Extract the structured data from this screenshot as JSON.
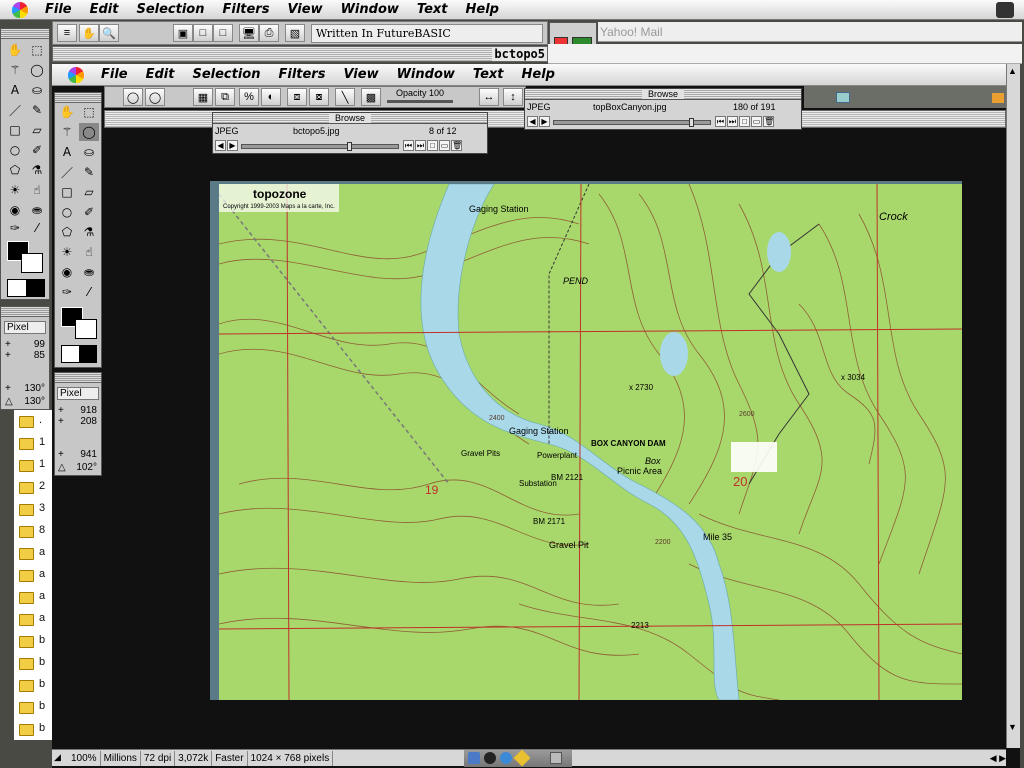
{
  "menu_outer": [
    "File",
    "Edit",
    "Selection",
    "Filters",
    "View",
    "Window",
    "Text",
    "Help"
  ],
  "menu_inner": [
    "File",
    "Edit",
    "Selection",
    "Filters",
    "View",
    "Window",
    "Text",
    "Help"
  ],
  "toolbar_outer_title": "Written In FutureBASIC",
  "doc_window_title": "bctopo5",
  "yahoo_title": "Yahoo! Mail",
  "toolbar_inner": {
    "opacity_label": "Opacity 100"
  },
  "browse_small": {
    "title": "Browse",
    "type": "JPEG",
    "filename": "bctopo5.jpg",
    "position": "8 of 12",
    "slider": 0.7
  },
  "browse_large": {
    "title": "Browse",
    "type": "JPEG",
    "filename": "topBoxCanyon.jpg",
    "position": "180 of 191",
    "slider": 0.9
  },
  "palette_outer": {
    "unit": "Pixel",
    "x": "99",
    "y": "85",
    "w": "130°",
    "h": "130°"
  },
  "palette_inner": {
    "unit": "Pixel",
    "x": "918",
    "y": "208",
    "w": "941",
    "h": "102°"
  },
  "finder_items": [
    ".",
    "1",
    "2",
    "3",
    "8",
    "a",
    "a",
    "a",
    "b",
    "b",
    "b",
    "b"
  ],
  "map": {
    "brand": "topozone",
    "copyright": "Copyright 1999-2003 Maps a la carte, Inc.",
    "labels": [
      "Gaging Station",
      "Gaging Station",
      "BOX CANYON DAM",
      "Powerplant",
      "Picnic Area",
      "Gravel Pits",
      "Gravel Pit",
      "Substation",
      "BM 2121",
      "BM 2171",
      "19",
      "20",
      "Crock",
      "PEND",
      "Box",
      "Mile 35",
      "x 2730",
      "x 3034",
      "2213",
      "2400",
      "2600",
      "2200"
    ]
  },
  "statusbar": [
    "100%",
    "Millions",
    "72 dpi",
    "3,072k",
    "Faster",
    "1024 × 768 pixels"
  ],
  "colors": {
    "map_bg": "#a6d86a",
    "river": "#a9d8e8",
    "contour": "#8a4a2a",
    "grid_red": "#c0302a"
  }
}
